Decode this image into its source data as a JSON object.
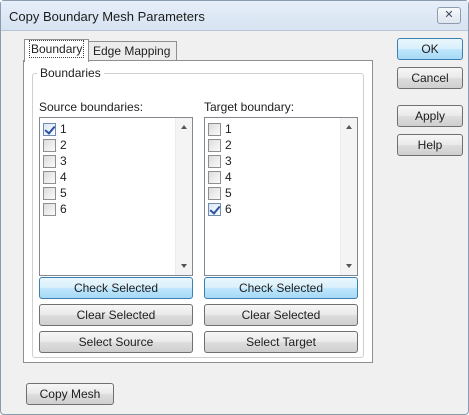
{
  "window": {
    "title": "Copy Boundary Mesh Parameters",
    "close_glyph": "✕"
  },
  "tabs": [
    {
      "label": "Boundary",
      "active": true
    },
    {
      "label": "Edge Mapping",
      "active": false
    }
  ],
  "boundaries_group": {
    "label": "Boundaries",
    "source": {
      "label": "Source boundaries:",
      "items": [
        {
          "label": "1",
          "checked": true
        },
        {
          "label": "2",
          "checked": false
        },
        {
          "label": "3",
          "checked": false
        },
        {
          "label": "4",
          "checked": false
        },
        {
          "label": "5",
          "checked": false
        },
        {
          "label": "6",
          "checked": false
        }
      ],
      "check_selected": "Check Selected",
      "clear_selected": "Clear Selected",
      "select_button": "Select Source"
    },
    "target": {
      "label": "Target boundary:",
      "items": [
        {
          "label": "1",
          "checked": false
        },
        {
          "label": "2",
          "checked": false
        },
        {
          "label": "3",
          "checked": false
        },
        {
          "label": "4",
          "checked": false
        },
        {
          "label": "5",
          "checked": false
        },
        {
          "label": "6",
          "checked": true
        }
      ],
      "check_selected": "Check Selected",
      "clear_selected": "Clear Selected",
      "select_button": "Select Target"
    }
  },
  "side_buttons": {
    "ok": "OK",
    "cancel": "Cancel",
    "apply": "Apply",
    "help": "Help"
  },
  "footer": {
    "copy_mesh": "Copy Mesh"
  },
  "colors": {
    "highlight_button": "#bee6fd",
    "dialog_background": "#f0f0f0",
    "checkmark": "#2c52a0"
  }
}
